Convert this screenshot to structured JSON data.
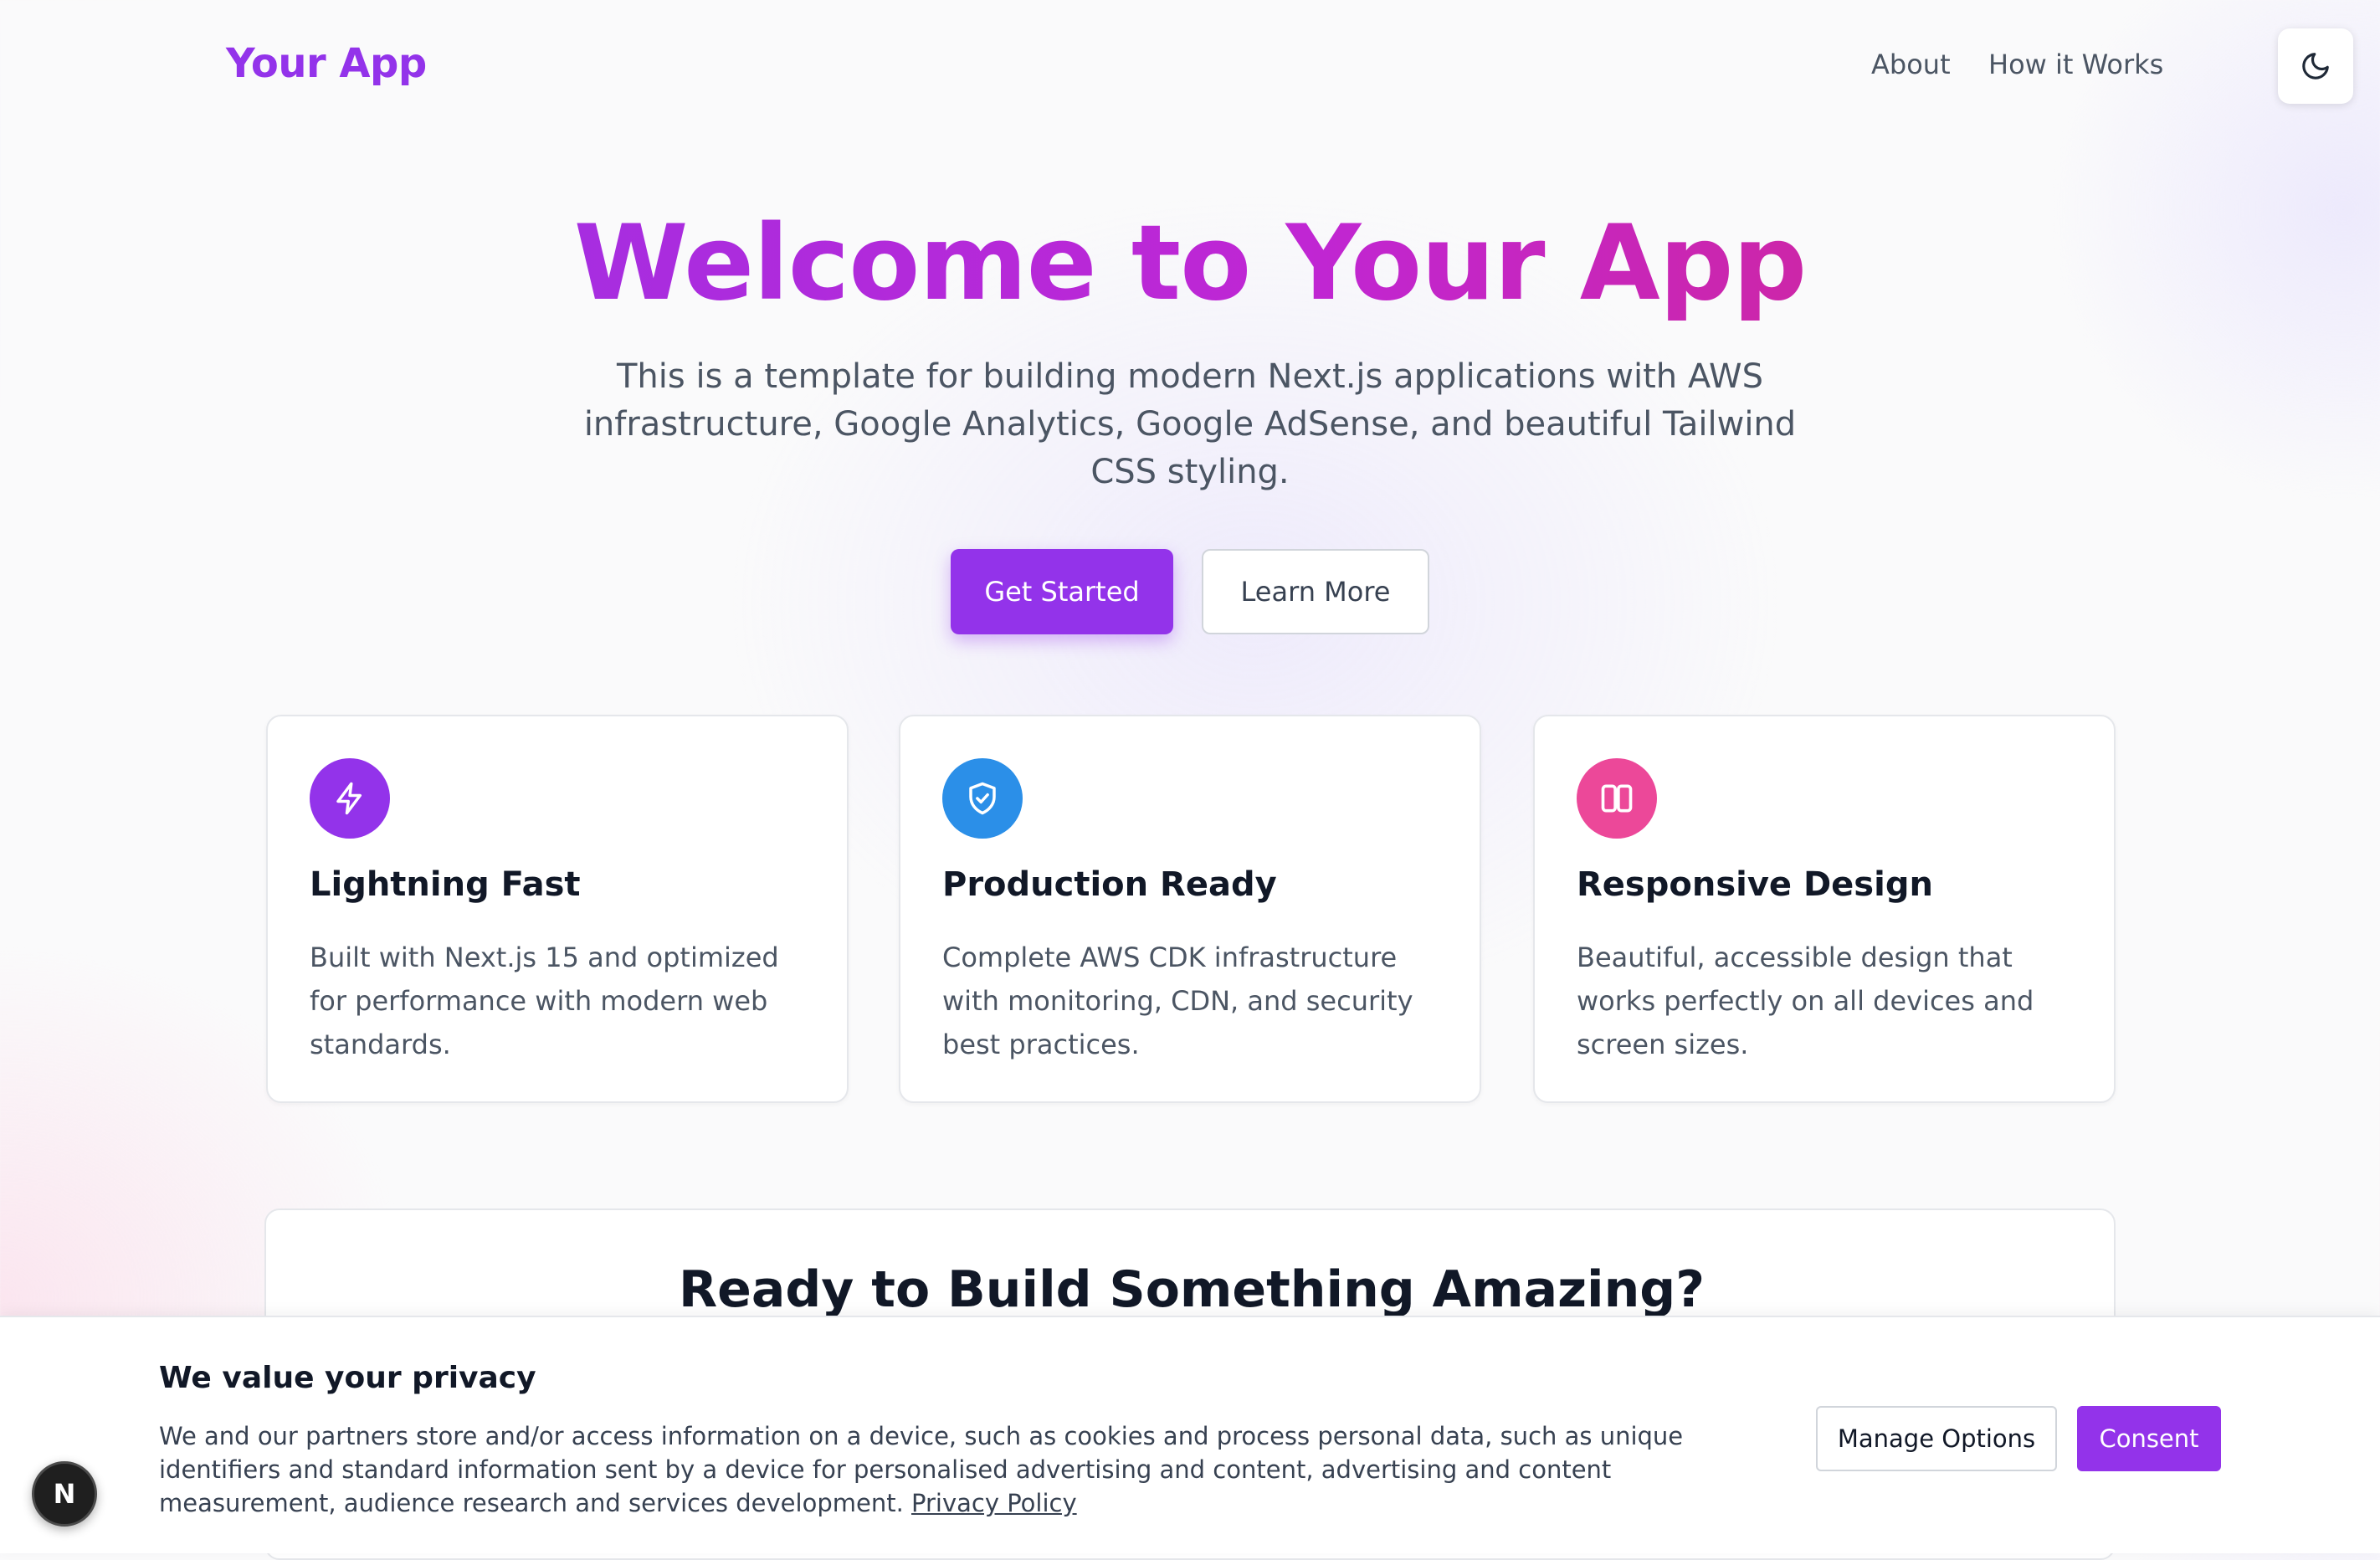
{
  "header": {
    "brand": "Your App",
    "nav": [
      {
        "label": "About"
      },
      {
        "label": "How it Works"
      }
    ],
    "theme_toggle_icon": "moon-icon"
  },
  "hero": {
    "title": "Welcome to Your App",
    "subtitle": "This is a template for building modern Next.js applications with AWS infrastructure, Google Analytics, Google AdSense, and beautiful Tailwind CSS styling.",
    "primary_button": "Get Started",
    "secondary_button": "Learn More"
  },
  "features": [
    {
      "icon": "lightning-icon",
      "color": "#9333ea",
      "title": "Lightning Fast",
      "description": "Built with Next.js 15 and optimized for performance with modern web standards."
    },
    {
      "icon": "shield-check-icon",
      "color": "#2b8fe8",
      "title": "Production Ready",
      "description": "Complete AWS CDK infrastructure with monitoring, CDN, and security best practices."
    },
    {
      "icon": "columns-icon",
      "color": "#ec4899",
      "title": "Responsive Design",
      "description": "Beautiful, accessible design that works perfectly on all devices and screen sizes."
    }
  ],
  "cta": {
    "title": "Ready to Build Something Amazing?"
  },
  "cookie_banner": {
    "title": "We value your privacy",
    "text": "We and our partners store and/or access information on a device, such as cookies and process personal data, such as unique identifiers and standard information sent by a device for personalised advertising and content, advertising and content measurement, audience research and services development.",
    "policy_link": "Privacy Policy",
    "manage_button": "Manage Options",
    "consent_button": "Consent"
  },
  "dev_badge": {
    "label": "N"
  },
  "colors": {
    "accent": "#9333ea",
    "gradient_end": "#db2777"
  }
}
